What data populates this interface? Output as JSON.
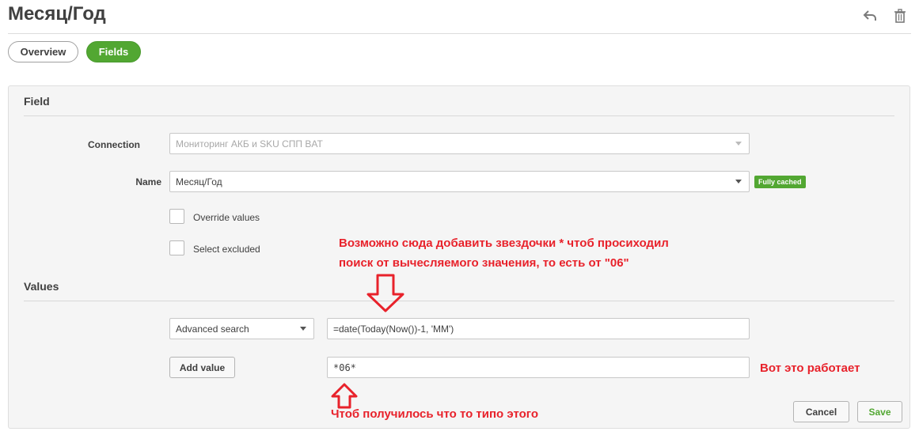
{
  "header": {
    "title": "Месяц/Год"
  },
  "tabs": [
    {
      "label": "Overview"
    },
    {
      "label": "Fields"
    }
  ],
  "field_section": {
    "title": "Field",
    "connection_label": "Connection",
    "connection_value": "Мониторинг АКБ и SKU СПП BAT",
    "name_label": "Name",
    "name_value": "Месяц/Год",
    "badge": "Fully cached",
    "override_label": "Override values",
    "select_excluded_label": "Select excluded"
  },
  "values_section": {
    "title": "Values",
    "search_mode": "Advanced search",
    "expression": "=date(Today(Now())-1, 'MM')",
    "add_value_label": "Add value",
    "value_input": "*06*"
  },
  "buttons": {
    "cancel": "Cancel",
    "save": "Save"
  },
  "annotations": {
    "line1": "Возможно сюда добавить звездочки * чтоб просиходил",
    "line2": "поиск от вычесляемого значения, то есть от \"06\"",
    "works": "Вот это работает",
    "goal": "Чтоб получилось что то типо этого"
  },
  "colors": {
    "accent": "#52a732",
    "annotation": "#e8222b"
  }
}
